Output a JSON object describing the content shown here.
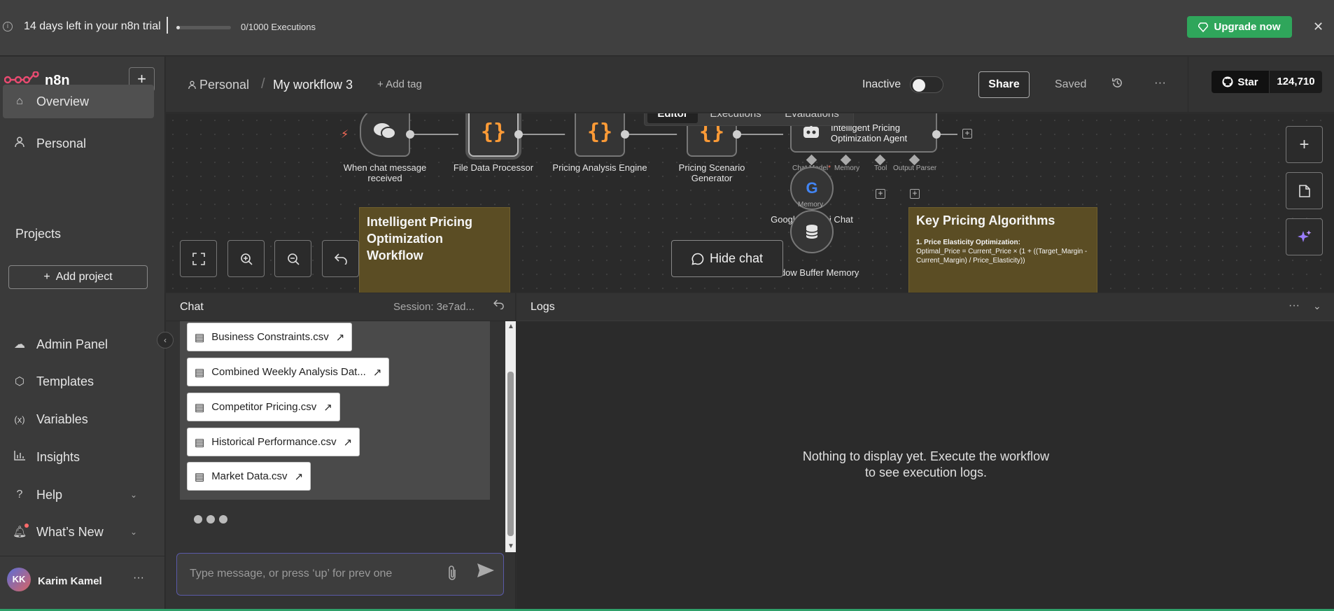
{
  "banner": {
    "trial_text": "14 days left in your n8n trial",
    "executions_text": "0/1000 Executions",
    "executions_progress": 0.0,
    "upgrade_label": "Upgrade now",
    "info_icon": "info-icon",
    "close_icon": "close-icon"
  },
  "sidebar": {
    "app_name": "n8n",
    "items": [
      {
        "label": "Overview",
        "icon": "home-icon"
      },
      {
        "label": "Personal",
        "icon": "user-icon"
      }
    ],
    "projects_title": "Projects",
    "add_project_label": "Add project",
    "bottom_items": [
      {
        "label": "Admin Panel",
        "icon": "cloud-icon"
      },
      {
        "label": "Templates",
        "icon": "box-icon"
      },
      {
        "label": "Variables",
        "icon": "variable-icon"
      },
      {
        "label": "Insights",
        "icon": "chart-icon"
      },
      {
        "label": "Help",
        "icon": "help-icon"
      },
      {
        "label": "What’s New",
        "icon": "bell-icon"
      }
    ],
    "user": {
      "initials": "KK",
      "name": "Karim Kamel"
    }
  },
  "header": {
    "breadcrumb_project": "Personal",
    "breadcrumb_sep": "/",
    "workflow_name": "My workflow 3",
    "add_tag": "+ Add tag",
    "status_label": "Inactive",
    "share_label": "Share",
    "saved_label": "Saved",
    "github_star_label": "Star",
    "github_star_count": "124,710"
  },
  "canvas": {
    "tabs": [
      {
        "label": "Editor",
        "active": true
      },
      {
        "label": "Executions",
        "active": false
      },
      {
        "label": "Evaluations",
        "active": false
      }
    ],
    "nodes": [
      {
        "label": "When chat message received",
        "type": "trigger"
      },
      {
        "label": "File Data Processor",
        "type": "code"
      },
      {
        "label": "Pricing Analysis Engine",
        "type": "code"
      },
      {
        "label": "Pricing Scenario Generator",
        "type": "code"
      },
      {
        "label": "Intelligent Pricing Optimization Agent",
        "type": "agent"
      }
    ],
    "agent_ports": [
      "Chat Model",
      "Memory",
      "Tool",
      "Output Parser"
    ],
    "agent_port_required": "*",
    "sub_nodes": [
      {
        "label": "Google Gemini Chat",
        "port": "Memory"
      },
      {
        "label": "Window Buffer Memory"
      }
    ],
    "sticky_1_title": "Intelligent Pricing Optimization Workflow",
    "sticky_2_title": "Key Pricing Algorithms",
    "sticky_2_subtitle": "1. Price Elasticity Optimization:",
    "sticky_2_body": "Optimal_Price = Current_Price × (1 + ((Target_Margin - Current_Margin) / Price_Elasticity))",
    "hide_chat_label": "Hide chat"
  },
  "chat": {
    "title": "Chat",
    "session": "Session: 3e7ad...",
    "files": [
      "Business Constraints.csv",
      "Combined Weekly Analysis Dat...",
      "Competitor Pricing.csv",
      "Historical Performance.csv",
      "Market Data.csv"
    ],
    "input_placeholder": "Type message, or press ‘up’ for prev one"
  },
  "logs": {
    "title": "Logs",
    "empty_text": "Nothing to display yet. Execute the workflow to see execution logs."
  },
  "colors": {
    "accent_green": "#2fa65b",
    "code_orange": "#ff9b36",
    "sticky_bg": "#5b4d24"
  }
}
